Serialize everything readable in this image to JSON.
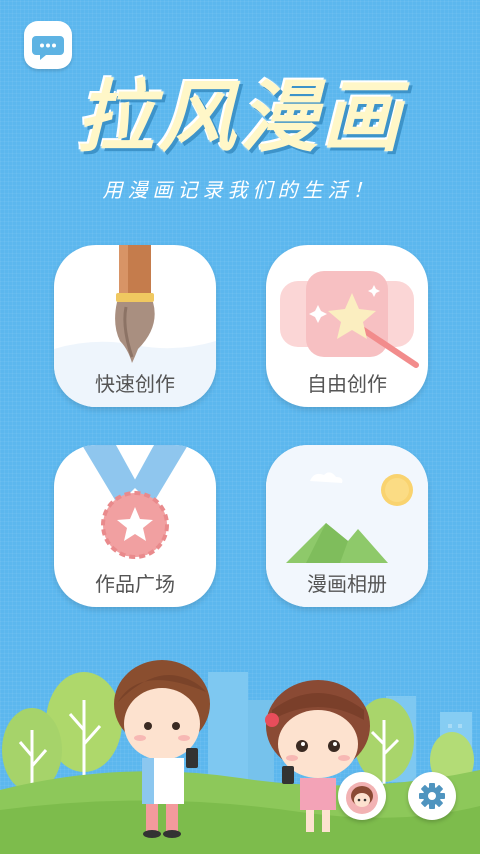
{
  "app": {
    "logo_text": "拉风漫画",
    "slogan": "用漫画记录我们的生活！"
  },
  "menu": [
    {
      "label": "快速创作"
    },
    {
      "label": "自由创作"
    },
    {
      "label": "作品广场"
    },
    {
      "label": "漫画相册"
    }
  ],
  "icons": {
    "message": "chat-bubble-icon",
    "avatar": "girl-avatar-icon",
    "settings": "gear-icon"
  },
  "colors": {
    "background": "#5cb7ee",
    "logo": "#fff7c8",
    "grass": "#8dc85a"
  }
}
